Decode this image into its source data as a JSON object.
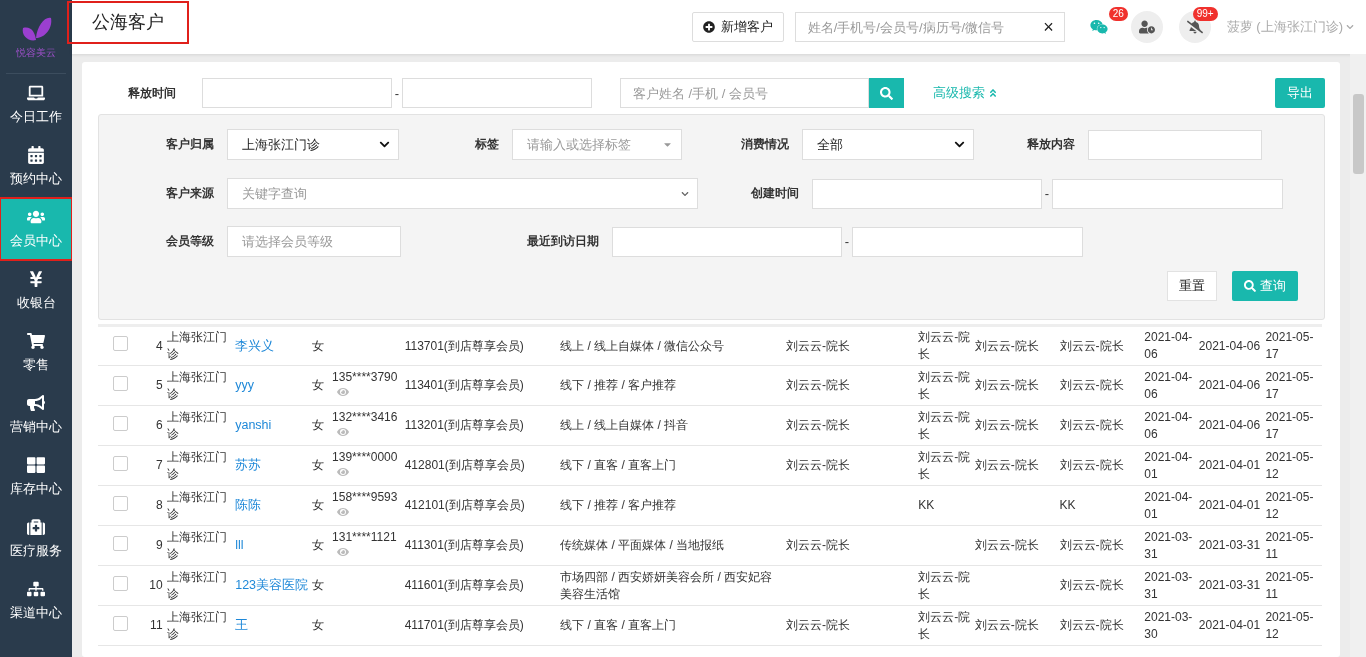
{
  "page_title": "公海客户",
  "logo_text": "悦容美云",
  "header": {
    "add_button": "新增客户",
    "search_placeholder": "姓名/手机号/会员号/病历号/微信号",
    "clear": "×",
    "chat_badge": "26",
    "notice_badge": "99+",
    "user": "菠萝 (上海张江门诊)"
  },
  "sidebar": [
    {
      "label": "今日工作",
      "selected": false
    },
    {
      "label": "预约中心",
      "selected": false
    },
    {
      "label": "会员中心",
      "selected": true
    },
    {
      "label": "收银台",
      "selected": false
    },
    {
      "label": "零售",
      "selected": false
    },
    {
      "label": "营销中心",
      "selected": false
    },
    {
      "label": "库存中心",
      "selected": false
    },
    {
      "label": "医疗服务",
      "selected": false
    },
    {
      "label": "渠道中心",
      "selected": false
    }
  ],
  "toolbar": {
    "release_time_label": "释放时间",
    "separator": "-",
    "search_placeholder": "客户姓名 /手机 / 会员号",
    "advanced_link": "高级搜索",
    "advanced_expanded": true,
    "export_button": "导出"
  },
  "advanced": {
    "owner": {
      "label": "客户归属",
      "value": "上海张江门诊"
    },
    "tag": {
      "label": "标签",
      "placeholder": "请输入或选择标签"
    },
    "consumption": {
      "label": "消费情况",
      "value": "全部"
    },
    "release_content": {
      "label": "释放内容"
    },
    "source": {
      "label": "客户来源",
      "placeholder": "关键字查询"
    },
    "created": {
      "label": "创建时间",
      "separator": "-"
    },
    "level": {
      "label": "会员等级",
      "placeholder": "请选择会员等级"
    },
    "last_visit": {
      "label": "最近到访日期",
      "separator": "-"
    },
    "reset_button": "重置",
    "query_button": "查询"
  },
  "table": {
    "rows": [
      {
        "checked": false,
        "index": "4",
        "clinic": "上海张江门诊",
        "name": "李兴义",
        "gender": "女",
        "phone": "",
        "member": "113701(到店尊享会员)",
        "source": "线上 / 线上自媒体 / 微信公众号",
        "column_1": "刘云云-院长",
        "column_2": "刘云云-院长",
        "column_3": "刘云云-院长",
        "column_4": "刘云云-院长",
        "date_1": "2021-04-06",
        "date_2": "2021-04-06",
        "date_3": "2021-05-17"
      },
      {
        "checked": false,
        "index": "5",
        "clinic": "上海张江门诊",
        "name": "yyy",
        "gender": "女",
        "phone": "135****3790",
        "member": "113401(到店尊享会员)",
        "source": "线下 / 推荐 / 客户推荐",
        "column_1": "刘云云-院长",
        "column_2": "刘云云-院长",
        "column_3": "刘云云-院长",
        "column_4": "刘云云-院长",
        "date_1": "2021-04-06",
        "date_2": "2021-04-06",
        "date_3": "2021-05-17"
      },
      {
        "checked": false,
        "index": "6",
        "clinic": "上海张江门诊",
        "name": "yanshi",
        "gender": "女",
        "phone": "132****3416",
        "member": "113201(到店尊享会员)",
        "source": "线上 / 线上自媒体 / 抖音",
        "column_1": "刘云云-院长",
        "column_2": "刘云云-院长",
        "column_3": "刘云云-院长",
        "column_4": "刘云云-院长",
        "date_1": "2021-04-06",
        "date_2": "2021-04-06",
        "date_3": "2021-05-17"
      },
      {
        "checked": false,
        "index": "7",
        "clinic": "上海张江门诊",
        "name": "苏苏",
        "gender": "女",
        "phone": "139****0000",
        "member": "412801(到店尊享会员)",
        "source": "线下 / 直客 / 直客上门",
        "column_1": "刘云云-院长",
        "column_2": "刘云云-院长",
        "column_3": "刘云云-院长",
        "column_4": "刘云云-院长",
        "date_1": "2021-04-01",
        "date_2": "2021-04-01",
        "date_3": "2021-05-12"
      },
      {
        "checked": false,
        "index": "8",
        "clinic": "上海张江门诊",
        "name": "陈陈",
        "gender": "女",
        "phone": "158****9593",
        "member": "412101(到店尊享会员)",
        "source": "线下 / 推荐 / 客户推荐",
        "column_1": "",
        "column_2": "KK",
        "column_3": "",
        "column_4": "KK",
        "date_1": "2021-04-01",
        "date_2": "2021-04-01",
        "date_3": "2021-05-12"
      },
      {
        "checked": false,
        "index": "9",
        "clinic": "上海张江门诊",
        "name": "lll",
        "gender": "女",
        "phone": "131****1121",
        "member": "411301(到店尊享会员)",
        "source": "传统媒体 / 平面媒体 / 当地报纸",
        "column_1": "刘云云-院长",
        "column_2": "",
        "column_3": "刘云云-院长",
        "column_4": "刘云云-院长",
        "date_1": "2021-03-31",
        "date_2": "2021-03-31",
        "date_3": "2021-05-11"
      },
      {
        "checked": false,
        "index": "10",
        "clinic": "上海张江门诊",
        "name": "123美容医院",
        "gender": "女",
        "phone": "",
        "member": "411601(到店尊享会员)",
        "source": "市场四部 / 西安娇妍美容会所 / 西安妃容美容生活馆",
        "column_1": "",
        "column_2": "刘云云-院长",
        "column_3": "",
        "column_4": "刘云云-院长",
        "date_1": "2021-03-31",
        "date_2": "2021-03-31",
        "date_3": "2021-05-11"
      },
      {
        "checked": false,
        "index": "11",
        "clinic": "上海张江门诊",
        "name": "王",
        "gender": "女",
        "phone": "",
        "member": "411701(到店尊享会员)",
        "source": "线下 / 直客 / 直客上门",
        "column_1": "刘云云-院长",
        "column_2": "刘云云-院长",
        "column_3": "刘云云-院长",
        "column_4": "刘云云-院长",
        "date_1": "2021-03-30",
        "date_2": "2021-04-01",
        "date_3": "2021-05-12"
      }
    ]
  }
}
